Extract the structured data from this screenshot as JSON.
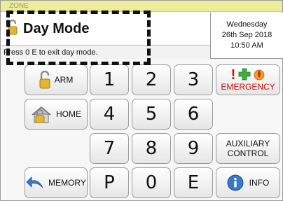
{
  "zone": {
    "label": "ZONE"
  },
  "mode": {
    "title": "Day Mode",
    "subtitle": "Press 0 E to exit day mode."
  },
  "datetime": {
    "day": "Wednesday",
    "date": "26th Sep 2018",
    "time": "10:50 AM"
  },
  "left_buttons": {
    "arm": "ARM",
    "home": "HOME",
    "memory": "MEMORY"
  },
  "keypad": {
    "k1": "1",
    "k2": "2",
    "k3": "3",
    "k4": "4",
    "k5": "5",
    "k6": "6",
    "k7": "7",
    "k8": "8",
    "k9": "9",
    "kP": "P",
    "k0": "0",
    "kE": "E"
  },
  "right_buttons": {
    "emergency": "EMERGENCY",
    "auxiliary_line1": "AUXILIARY",
    "auxiliary_line2": "CONTROL",
    "info": "INFO"
  },
  "colors": {
    "zone_bar": "#ecec9a",
    "emergency_text": "#d01010",
    "lock_gold": "#e6b52a",
    "info_blue": "#3a78c8"
  }
}
